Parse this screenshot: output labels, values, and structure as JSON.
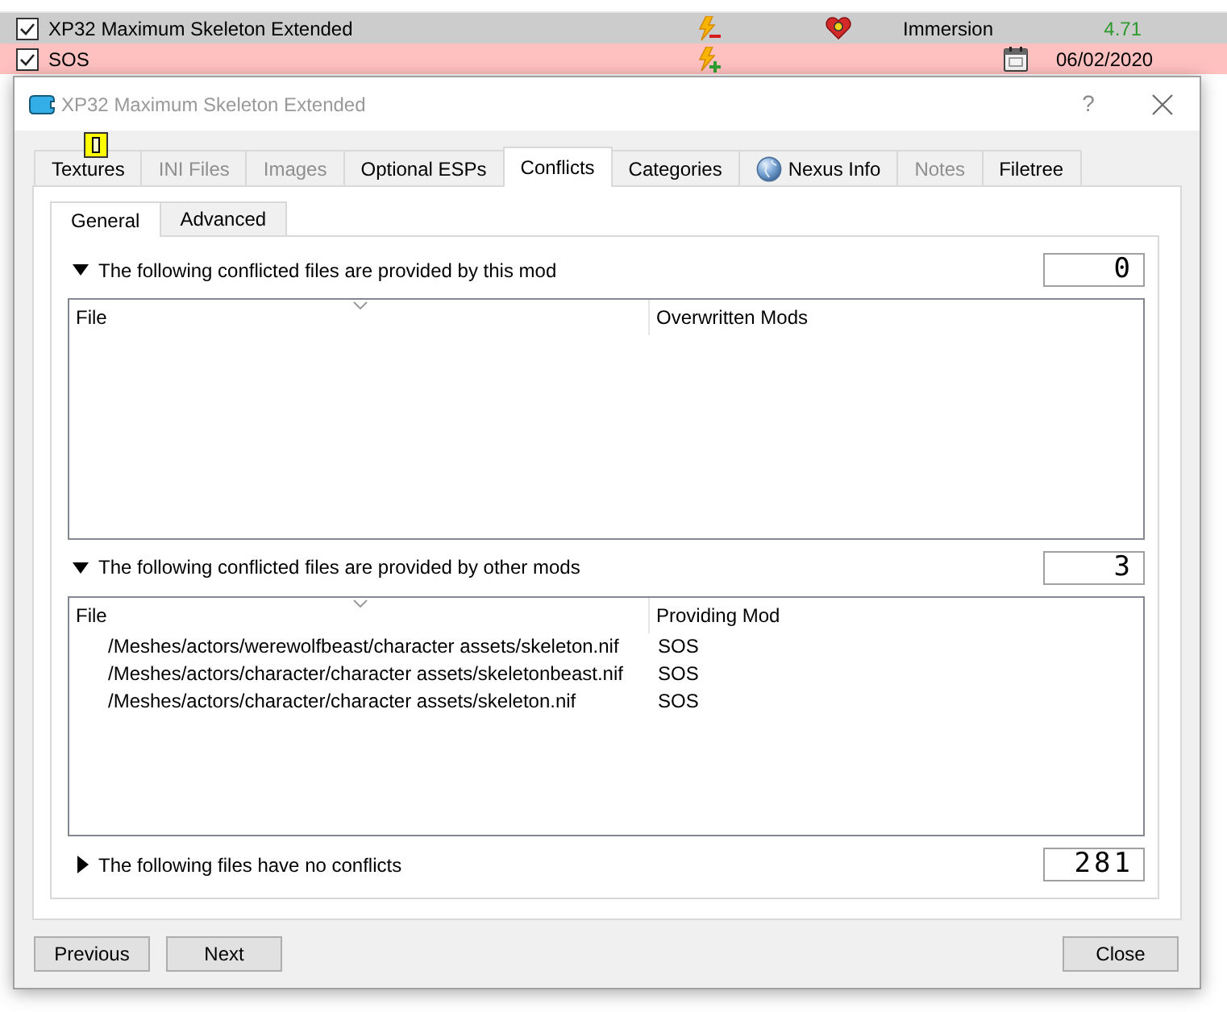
{
  "mod_list": {
    "rows": [
      {
        "checked": true,
        "name": "XP32 Maximum Skeleton Extended",
        "selected": true,
        "highlighted": false,
        "overwrites": false,
        "overwritten": true,
        "flagged": true,
        "category": "Immersion",
        "version": {
          "kind": "release",
          "text": "4.71"
        }
      },
      {
        "checked": true,
        "name": "SOS",
        "selected": false,
        "highlighted": true,
        "overwrites": true,
        "overwritten": false,
        "flagged": false,
        "version": {
          "kind": "date",
          "text": "06/02/2020"
        }
      }
    ]
  },
  "dialog": {
    "title": "XP32 Maximum Skeleton Extended",
    "help_button": "?",
    "tabs": [
      {
        "label": "Textures",
        "selected": false,
        "disabled": false,
        "icon": false
      },
      {
        "label": "INI Files",
        "selected": false,
        "disabled": true,
        "icon": false
      },
      {
        "label": "Images",
        "selected": false,
        "disabled": true,
        "icon": false
      },
      {
        "label": "Optional ESPs",
        "selected": false,
        "disabled": false,
        "icon": false
      },
      {
        "label": "Conflicts",
        "selected": true,
        "disabled": false,
        "icon": false
      },
      {
        "label": "Categories",
        "selected": false,
        "disabled": false,
        "icon": false
      },
      {
        "label": "Nexus Info",
        "selected": false,
        "disabled": false,
        "icon": true
      },
      {
        "label": "Notes",
        "selected": false,
        "disabled": true,
        "icon": false
      },
      {
        "label": "Filetree",
        "selected": false,
        "disabled": false,
        "icon": false
      }
    ],
    "subtabs": [
      {
        "label": "General",
        "selected": true
      },
      {
        "label": "Advanced",
        "selected": false
      }
    ],
    "sections": [
      {
        "label": "The following conflicted files are provided by this mod",
        "expanded": true,
        "count": "0",
        "columns": [
          "File",
          "Overwritten Mods"
        ]
      },
      {
        "label": "The following conflicted files are provided by other mods",
        "expanded": true,
        "count": "3",
        "columns": [
          "File",
          "Providing Mod"
        ],
        "rows": [
          {
            "file": "/Meshes/actors/werewolfbeast/character assets/skeleton.nif",
            "mod": "SOS"
          },
          {
            "file": "/Meshes/actors/character/character assets/skeletonbeast.nif",
            "mod": "SOS"
          },
          {
            "file": "/Meshes/actors/character/character assets/skeleton.nif",
            "mod": "SOS"
          }
        ]
      },
      {
        "label": "The following files have no conflicts",
        "expanded": false,
        "count": "281"
      }
    ],
    "nav_buttons": [
      "Previous",
      "Next"
    ],
    "close_button": "Close"
  }
}
